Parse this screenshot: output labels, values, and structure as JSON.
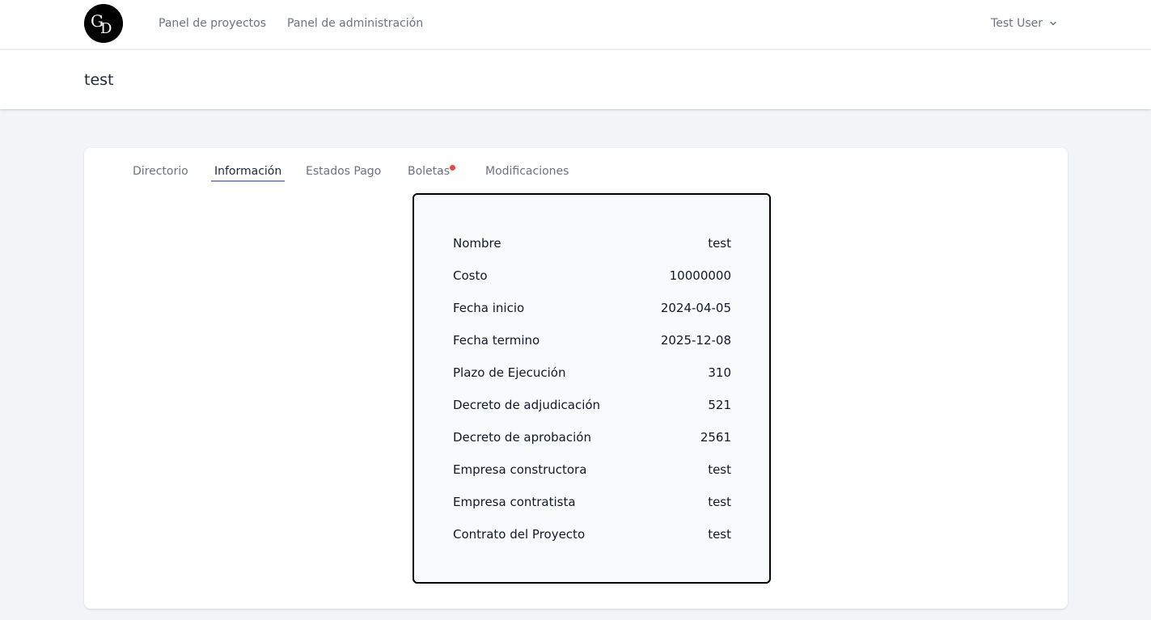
{
  "nav": {
    "logo_text": "GD",
    "links": [
      "Panel de proyectos",
      "Panel de administración"
    ],
    "user_name": "Test User"
  },
  "page": {
    "title": "test"
  },
  "tabs": [
    {
      "label": "Directorio",
      "active": false
    },
    {
      "label": "Información",
      "active": true
    },
    {
      "label": "Estados Pago",
      "active": false
    },
    {
      "label": "Boletas",
      "active": false,
      "notification": true
    },
    {
      "label": "Modificaciones",
      "active": false
    }
  ],
  "info": {
    "rows": [
      {
        "label": "Nombre",
        "value": "test"
      },
      {
        "label": "Costo",
        "value": "10000000"
      },
      {
        "label": "Fecha inicio",
        "value": "2024-04-05"
      },
      {
        "label": "Fecha termino",
        "value": "2025-12-08"
      },
      {
        "label": "Plazo de Ejecución",
        "value": "310"
      },
      {
        "label": "Decreto de adjudicación",
        "value": "521"
      },
      {
        "label": "Decreto de aprobación",
        "value": "2561"
      },
      {
        "label": "Empresa constructora",
        "value": "test"
      },
      {
        "label": "Empresa contratista",
        "value": "test"
      },
      {
        "label": "Contrato del Proyecto",
        "value": "test"
      }
    ]
  },
  "colors": {
    "active_tab_underline": "#8b93d8",
    "notification_dot": "#ef4444",
    "page_background": "#f3f4f6"
  }
}
